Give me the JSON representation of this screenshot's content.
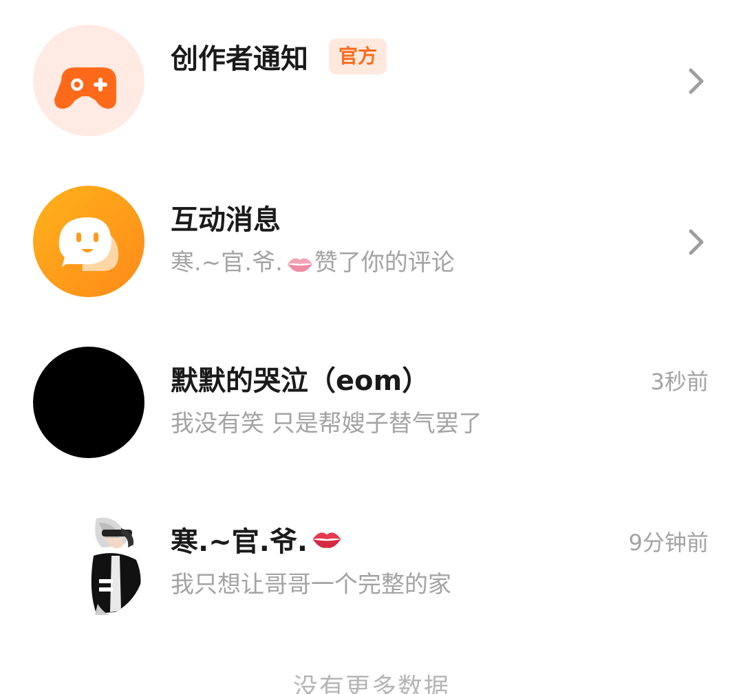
{
  "messages": [
    {
      "title": "创作者通知",
      "badge": "官方",
      "subtitle": "",
      "time": "",
      "avatar_icon": "gamepad-icon",
      "avatar_color": "#ffeae4",
      "icon_color": "#ff6a1a"
    },
    {
      "title": "互动消息",
      "subtitle_name": "寒.~官.爷.",
      "subtitle_action": "赞了你的评论",
      "time": "",
      "avatar_icon": "chat-face-icon",
      "avatar_color": "#ff9a1c"
    },
    {
      "title": "默默的哭泣（eom）",
      "subtitle": "我没有笑  只是帮嫂子替气罢了",
      "time": "3秒前",
      "avatar_color": "#000000"
    },
    {
      "title": "寒.~官.爷.",
      "subtitle": "我只想让哥哥一个完整的家",
      "time": "9分钟前"
    }
  ],
  "footer": "没有更多数据",
  "colors": {
    "title": "#1a1a1a",
    "secondary": "#a3a3a3",
    "accent": "#ff6a1a",
    "badge_bg": "#ffe9df"
  }
}
